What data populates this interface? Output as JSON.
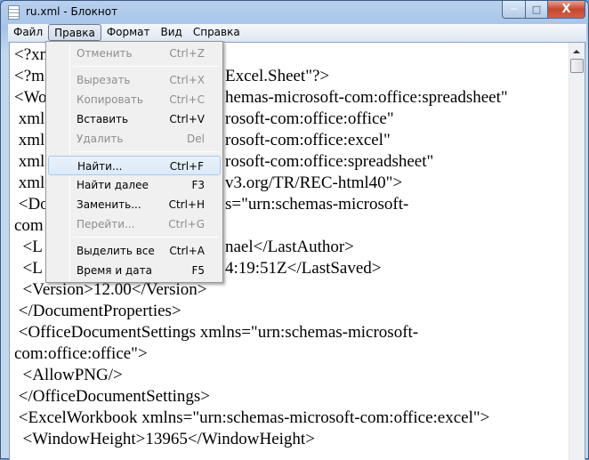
{
  "window": {
    "title": "ru.xml - Блокнот",
    "minimize": "─",
    "maximize": "□",
    "close": "X"
  },
  "menubar": [
    "Файл",
    "Правка",
    "Формат",
    "Вид",
    "Справка"
  ],
  "edit_menu": [
    {
      "label": "Отменить",
      "shortcut": "Ctrl+Z",
      "disabled": true
    },
    {
      "separator": true
    },
    {
      "label": "Вырезать",
      "shortcut": "Ctrl+X",
      "disabled": true
    },
    {
      "label": "Копировать",
      "shortcut": "Ctrl+C",
      "disabled": true
    },
    {
      "label": "Вставить",
      "shortcut": "Ctrl+V",
      "disabled": false
    },
    {
      "label": "Удалить",
      "shortcut": "Del",
      "disabled": true
    },
    {
      "separator": true
    },
    {
      "label": "Найти...",
      "shortcut": "Ctrl+F",
      "disabled": false,
      "highlighted": true
    },
    {
      "label": "Найти далее",
      "shortcut": "F3",
      "disabled": false
    },
    {
      "label": "Заменить...",
      "shortcut": "Ctrl+H",
      "disabled": false
    },
    {
      "label": "Перейти...",
      "shortcut": "Ctrl+G",
      "disabled": true
    },
    {
      "separator": true
    },
    {
      "label": "Выделить все",
      "shortcut": "Ctrl+A",
      "disabled": false
    },
    {
      "label": "Время и дата",
      "shortcut": "F5",
      "disabled": false
    }
  ],
  "text_lines": [
    {
      "left": "<?xn",
      "right": ""
    },
    {
      "left": "<?m",
      "right": "Excel.Sheet\"?>"
    },
    {
      "left": "<Wo",
      "right": "hemas-microsoft-com:office:spreadsheet\""
    },
    {
      "left": " xml",
      "right": "rosoft-com:office:office\""
    },
    {
      "left": " xml",
      "right": "rosoft-com:office:excel\""
    },
    {
      "left": " xml",
      "right": "rosoft-com:office:spreadsheet\""
    },
    {
      "left": " xml",
      "right": "v3.org/TR/REC-html40\">"
    },
    {
      "left": " <Do",
      "right": "s=\"urn:schemas-microsoft-"
    },
    {
      "left": "com",
      "right": ""
    },
    {
      "left": "  <L",
      "right": "nael</LastAuthor>"
    },
    {
      "left": "  <L",
      "right": "4:19:51Z</LastSaved>"
    },
    {
      "left": "  <Version>12.00</Version>",
      "right": ""
    },
    {
      "left": " </DocumentProperties>",
      "right": ""
    },
    {
      "left": " <OfficeDocumentSettings xmlns=\"urn:schemas-microsoft-",
      "right": ""
    },
    {
      "left": "com:office:office\">",
      "right": ""
    },
    {
      "left": "  <AllowPNG/>",
      "right": ""
    },
    {
      "left": " </OfficeDocumentSettings>",
      "right": ""
    },
    {
      "left": " <ExcelWorkbook xmlns=\"urn:schemas-microsoft-com:office:excel\">",
      "right": ""
    },
    {
      "left": "  <WindowHeight>13965</WindowHeight>",
      "right": ""
    }
  ]
}
